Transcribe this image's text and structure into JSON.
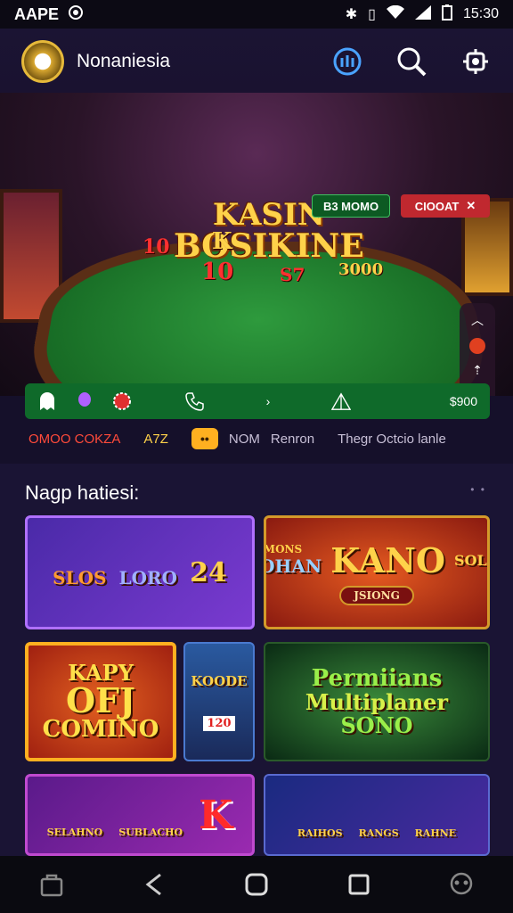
{
  "status_bar": {
    "carrier": "AAPE",
    "time": "15:30"
  },
  "app_bar": {
    "title": "Nonaniesia"
  },
  "hero": {
    "title_line1": "KASIN",
    "title_line2": "BOSIKINE",
    "btn_left": "B3 MOMO",
    "btn_right": "CIOOAT",
    "table_labels": [
      "10",
      "K",
      "10",
      "S7",
      "3000"
    ]
  },
  "quickbar": {
    "value": "$900"
  },
  "ticker": {
    "item1": "OMOO COKZA",
    "item2": "A7Z",
    "coin": "••",
    "item3": "NOM",
    "item4": "Renron",
    "item5": "Thegr Octcio lanle"
  },
  "section": {
    "title": "Nagp hatiesi:",
    "more": "• •"
  },
  "games": [
    {
      "line1": "SLOS",
      "line2": "LORO",
      "line3": "24"
    },
    {
      "line1": "MONS",
      "line2": "DOHAN",
      "line3": "KANO",
      "line4": "SOLOS",
      "line5": "JSIONG"
    },
    {
      "line1": "KAPY",
      "line2": "OFJ",
      "line3": "COMINO"
    },
    {
      "line1": "KOODE",
      "line2": "120"
    },
    {
      "line1": "Permiians",
      "line2": "Multiplaner",
      "line3": "SONO"
    },
    {
      "line1": "SELAHNO",
      "line2": "SUBLACHO",
      "line3": "K"
    },
    {
      "line1": "RAIHOS",
      "line2": "RANGS",
      "line3": "RAHNE"
    }
  ],
  "colors": {
    "accent_green": "#0f6a2a",
    "accent_red": "#c0282f",
    "gold": "#ffd24a"
  }
}
